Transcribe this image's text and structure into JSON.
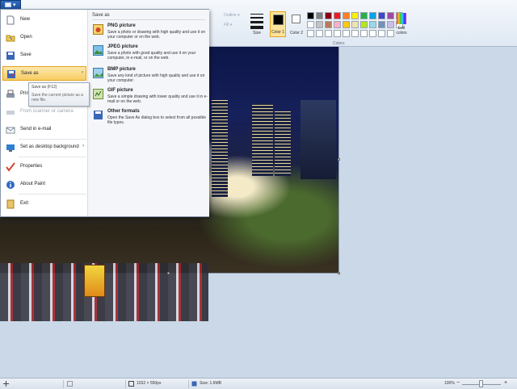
{
  "ribbon": {
    "outline_label": "Outline ▾",
    "fill_label": "Fill ▾",
    "size_label": "Size",
    "color1_label": "Color 1",
    "color2_label": "Color 2",
    "edit_colors_label": "Edit colors",
    "colors_group_label": "Colors",
    "palette": [
      "#000000",
      "#7f7f7f",
      "#880015",
      "#ed1c24",
      "#ff7f27",
      "#fff200",
      "#22b14c",
      "#00a2e8",
      "#3f48cc",
      "#a349a4",
      "#ffffff",
      "#ffffff",
      "#c3c3c3",
      "#b97a57",
      "#ffaec9",
      "#ffc90e",
      "#efe4b0",
      "#b5e61d",
      "#99d9ea",
      "#7092be",
      "#c8bfe7",
      "#ffffff",
      "#ffffff",
      "#ffffff",
      "#ffffff",
      "#ffffff",
      "#ffffff",
      "#ffffff",
      "#ffffff",
      "#ffffff",
      "#ffffff",
      "#ffffff"
    ]
  },
  "file_menu": {
    "items": [
      {
        "label": "New",
        "icon": "new-file-icon"
      },
      {
        "label": "Open",
        "icon": "open-folder-icon"
      },
      {
        "label": "Save",
        "icon": "save-icon"
      },
      {
        "label": "Save as",
        "icon": "save-as-icon"
      },
      {
        "label": "Print",
        "icon": "print-icon"
      },
      {
        "label": "From scanner or camera",
        "icon": "scanner-icon"
      },
      {
        "label": "Send in e-mail",
        "icon": "email-icon"
      },
      {
        "label": "Set as desktop background",
        "icon": "desktop-icon"
      },
      {
        "label": "Properties",
        "icon": "properties-icon"
      },
      {
        "label": "About Paint",
        "icon": "info-icon"
      },
      {
        "label": "Exit",
        "icon": "exit-icon"
      }
    ],
    "save_as_panel": {
      "title": "Save as",
      "options": [
        {
          "title": "PNG picture",
          "desc": "Save a photo or drawing with high quality and use it on your computer or on the web."
        },
        {
          "title": "JPEG picture",
          "desc": "Save a photo with good quality and use it on your computer, in e-mail, or on the web."
        },
        {
          "title": "BMP picture",
          "desc": "Save any kind of picture with high quality and use it on your computer."
        },
        {
          "title": "GIF picture",
          "desc": "Save a simple drawing with lower quality and use it in e-mail or on the web."
        },
        {
          "title": "Other formats",
          "desc": "Open the Save As dialog box to select from all possible file types."
        }
      ]
    },
    "tooltip": {
      "title": "Save as (F12)",
      "body": "Save the current picture as a new file."
    }
  },
  "status_bar": {
    "dimensions": "1032 × 550px",
    "size_on_disk": "Size: 1.6MB",
    "zoom": "100%"
  }
}
